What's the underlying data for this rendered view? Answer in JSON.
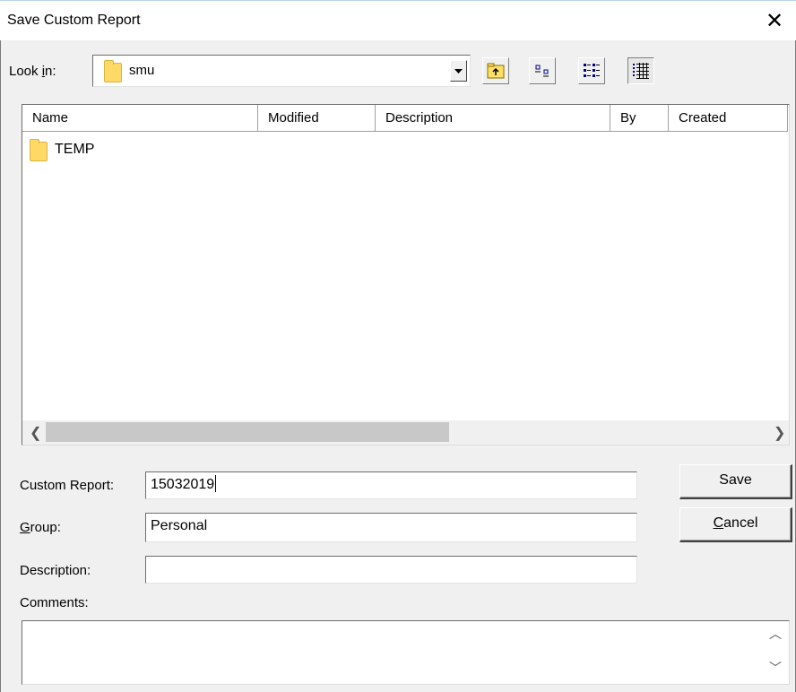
{
  "window": {
    "title": "Save Custom Report",
    "close_glyph": "✕"
  },
  "lookin": {
    "label_prefix": "Look ",
    "label_accel": "i",
    "label_suffix": "n:",
    "value": "smu",
    "toolbar_icons": [
      "up-one-level-icon",
      "list-view-icon",
      "details-view-icon",
      "all-view-icon"
    ]
  },
  "filelist": {
    "columns": [
      "Name",
      "Modified",
      "Description",
      "By",
      "Created"
    ],
    "rows": [
      {
        "name": "TEMP",
        "type": "folder"
      }
    ]
  },
  "form": {
    "custom_report_label": "Custom Report:",
    "custom_report_value": "15032019",
    "group_label_accel": "G",
    "group_label_rest": "roup:",
    "group_value": "Personal",
    "description_label": "Description:",
    "description_value": "",
    "comments_label": "Comments:",
    "comments_value": ""
  },
  "buttons": {
    "save": "Save",
    "cancel_accel": "C",
    "cancel_rest": "ancel"
  },
  "colors": {
    "dialog_bg": "#f0f0f0",
    "folder_yellow": "#ffd966",
    "scroll_thumb": "#c8c8c8"
  }
}
